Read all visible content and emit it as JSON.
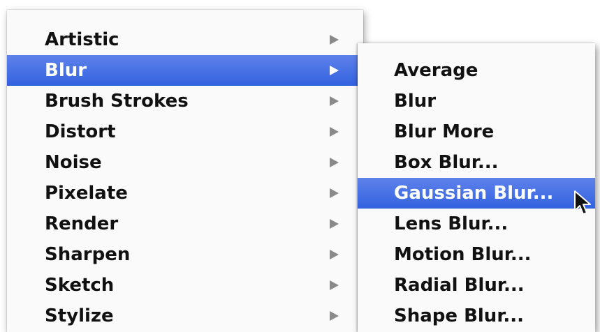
{
  "filter_menu": {
    "items": [
      {
        "label": "Artistic"
      },
      {
        "label": "Blur"
      },
      {
        "label": "Brush Strokes"
      },
      {
        "label": "Distort"
      },
      {
        "label": "Noise"
      },
      {
        "label": "Pixelate"
      },
      {
        "label": "Render"
      },
      {
        "label": "Sharpen"
      },
      {
        "label": "Sketch"
      },
      {
        "label": "Stylize"
      }
    ],
    "selected_label": "Blur"
  },
  "blur_submenu": {
    "items": [
      {
        "label": "Average"
      },
      {
        "label": "Blur"
      },
      {
        "label": "Blur More"
      },
      {
        "label": "Box Blur..."
      },
      {
        "label": "Gaussian Blur..."
      },
      {
        "label": "Lens Blur..."
      },
      {
        "label": "Motion Blur..."
      },
      {
        "label": "Radial Blur..."
      },
      {
        "label": "Shape Blur..."
      }
    ],
    "highlighted_label": "Gaussian Blur..."
  },
  "colors": {
    "highlight": "#3d6ae2",
    "menu_background": "#fafafa",
    "text": "#111111",
    "arrow": "#8a8a8a"
  },
  "icons": {
    "submenu_arrow": "triangle-right-icon",
    "pointer": "mouse-pointer-icon"
  }
}
